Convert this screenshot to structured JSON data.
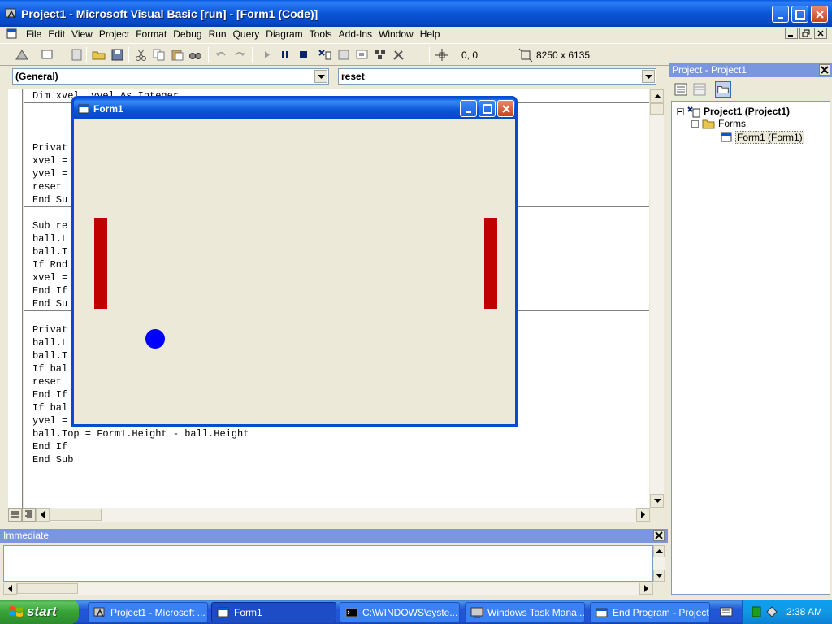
{
  "window": {
    "title": "Project1 - Microsoft Visual Basic [run] - [Form1 (Code)]"
  },
  "menu": {
    "items": [
      "File",
      "Edit",
      "View",
      "Project",
      "Format",
      "Debug",
      "Run",
      "Query",
      "Diagram",
      "Tools",
      "Add-Ins",
      "Window",
      "Help"
    ]
  },
  "toolbar": {
    "position": "0, 0",
    "size": "8250 x 6135"
  },
  "code": {
    "object_combo": "(General)",
    "proc_combo": "reset",
    "lines": [
      "Dim xvel, yvel As Integer",
      "",
      "",
      "",
      "Privat",
      "xvel =",
      "yvel =",
      "reset",
      "End Su",
      "",
      "Sub re",
      "ball.L",
      "ball.T",
      "If Rnd",
      "xvel =",
      "End If",
      "End Su",
      "",
      "Privat",
      "ball.L",
      "ball.T",
      "If bal",
      "reset",
      "End If",
      "If bal",
      "yvel =",
      "ball.Top = Form1.Height - ball.Height",
      "End If",
      "End Sub"
    ]
  },
  "project": {
    "panel_title": "Project - Project1",
    "tree": [
      {
        "label": "Project1 (Project1)",
        "bold": true
      },
      {
        "label": "Forms",
        "bold": false
      },
      {
        "label": "Form1 (Form1)",
        "bold": false
      }
    ]
  },
  "immediate": {
    "title": "Immediate"
  },
  "form1": {
    "title": "Form1"
  },
  "taskbar": {
    "start": "start",
    "tasks": [
      "Project1 - Microsoft ...",
      "Form1",
      "C:\\WINDOWS\\syste...",
      "Windows Task Mana...",
      "End Program - Project1"
    ],
    "clock": "2:38 AM"
  },
  "colors": {
    "paddle": "#c00000",
    "ball": "#0000ff",
    "xp_blue": "#0b55d8"
  }
}
